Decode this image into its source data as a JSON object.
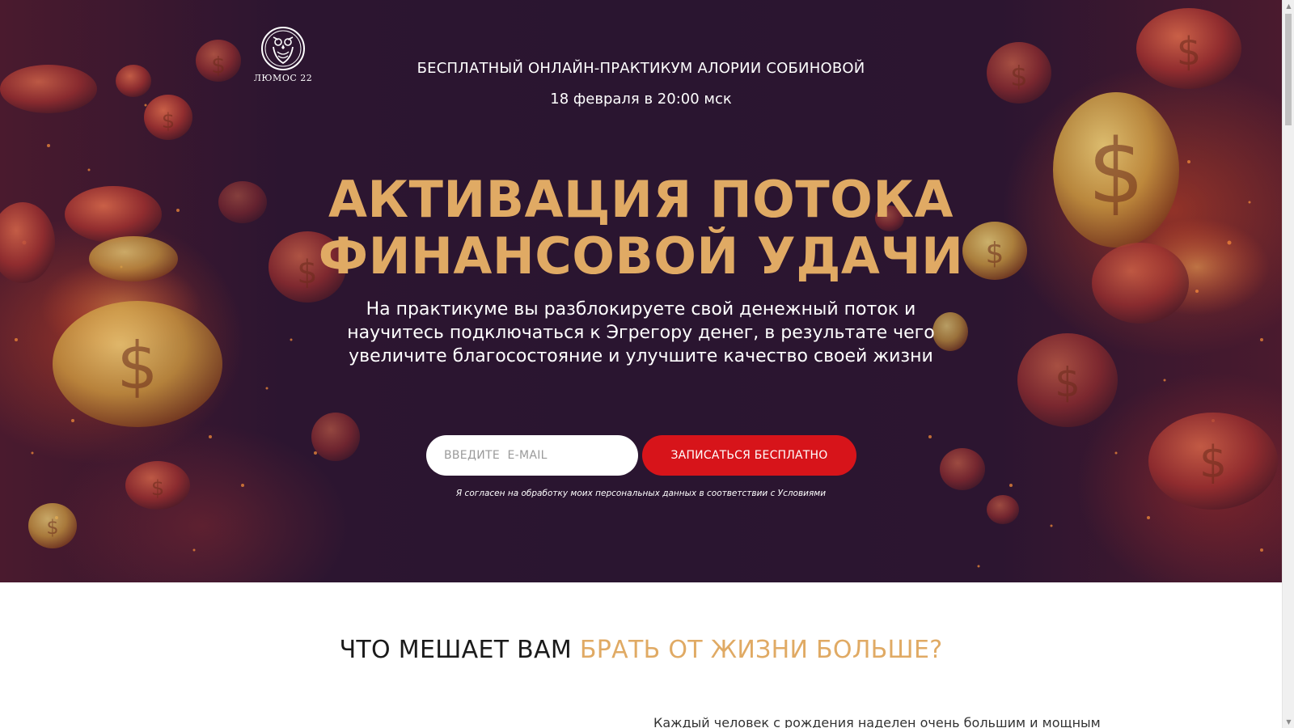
{
  "colors": {
    "hero_bg": "#2a1530",
    "gold_accent": "#e0aa64",
    "cta_red": "#d7141a",
    "text_white": "#ffffff",
    "section_text": "#1a1a1a"
  },
  "logo": {
    "icon": "owl-icon",
    "text": "ЛЮМОС 22"
  },
  "hero": {
    "eyebrow": "БЕСПЛАТНЫЙ ОНЛАЙН-ПРАКТИКУМ АЛОРИИ СОБИНОВОЙ",
    "date": "18 февраля в 20:00 мск",
    "headline_line1": "АКТИВАЦИЯ ПОТОКА",
    "headline_line2": "ФИНАНСОВОЙ УДАЧИ",
    "subtitle_line1": "На практикуме вы разблокируете свой денежный поток и",
    "subtitle_line2": "научитесь подключаться к Эгрегору денег, в результате чего",
    "subtitle_line3": "увеличите благосостояние и улучшите качество своей жизни"
  },
  "form": {
    "email_placeholder": "ВВЕДИТЕ  E-MAIL",
    "email_value": "",
    "submit_label": "ЗАПИСАТЬСЯ БЕСПЛАТНО",
    "consent_text": "Я согласен на обработку моих персональных данных в соответствии с Условиями"
  },
  "section2": {
    "title_plain": "ЧТО МЕШАЕТ ВАМ ",
    "title_accent": "БРАТЬ ОТ ЖИЗНИ БОЛЬШЕ?",
    "body_first_line": "Каждый человек с рождения наделен очень большим и мощным"
  },
  "scrollbar": {
    "up_icon": "scroll-up-arrow-icon",
    "down_icon": "scroll-down-arrow-icon"
  }
}
